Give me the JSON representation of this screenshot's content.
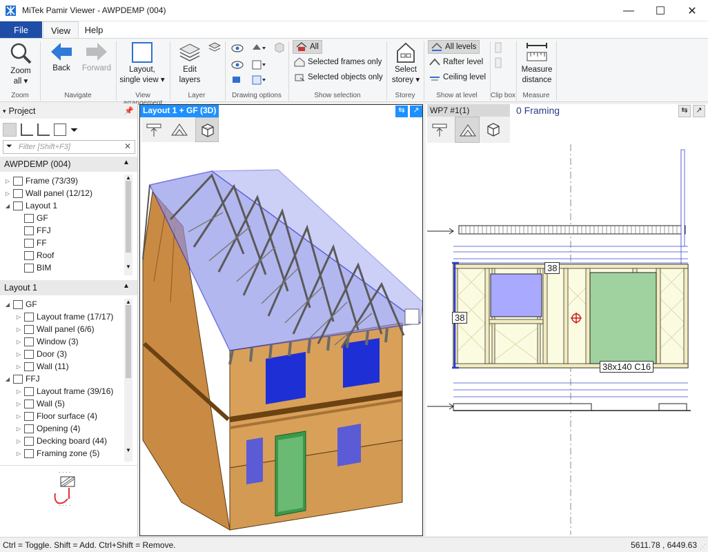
{
  "window": {
    "title": "MiTek Pamir Viewer - AWPDEMP (004)",
    "minimize": "—",
    "maximize": "☐",
    "close": "✕"
  },
  "tabs": {
    "file": "File",
    "view": "View",
    "help": "Help"
  },
  "ribbon": {
    "zoom": {
      "label": "Zoom all ▾",
      "group": "Zoom"
    },
    "back": "Back",
    "forward": "Forward",
    "navigate_group": "Navigate",
    "layout": {
      "label": "Layout, single view ▾",
      "group": "View arrangement"
    },
    "edit_layers": "Edit layers",
    "layer_group": "Layer",
    "drawing_group": "Drawing options",
    "all": "All",
    "selected_frames": "Selected frames only",
    "selected_objects": "Selected objects only",
    "selection_group": "Show selection",
    "select_storey": "Select storey ▾",
    "storey_group": "Storey",
    "all_levels": "All levels",
    "rafter_level": "Rafter level",
    "ceiling_level": "Ceiling level",
    "level_group": "Show at level",
    "clipbox_group": "Clip box",
    "measure": "Measure distance",
    "measure_group": "Measure"
  },
  "left": {
    "project_title": "Project",
    "filter_placeholder": "Filter [Shift+F3]",
    "section1": "AWPDEMP (004)",
    "tree1": [
      {
        "label": "Frame (73/39)",
        "exp": "▷",
        "indent": 0
      },
      {
        "label": "Wall panel (12/12)",
        "exp": "▷",
        "indent": 0
      },
      {
        "label": "Layout 1",
        "exp": "◢",
        "indent": 0
      },
      {
        "label": "GF",
        "exp": "",
        "indent": 1
      },
      {
        "label": "FFJ",
        "exp": "",
        "indent": 1
      },
      {
        "label": "FF",
        "exp": "",
        "indent": 1
      },
      {
        "label": "Roof",
        "exp": "",
        "indent": 1
      },
      {
        "label": "BIM",
        "exp": "",
        "indent": 1
      }
    ],
    "section2": "Layout 1",
    "tree2": [
      {
        "label": "GF",
        "exp": "◢",
        "indent": 0
      },
      {
        "label": "Layout frame (17/17)",
        "exp": "▷",
        "indent": 1
      },
      {
        "label": "Wall panel (6/6)",
        "exp": "▷",
        "indent": 1
      },
      {
        "label": "Window (3)",
        "exp": "▷",
        "indent": 1
      },
      {
        "label": "Door (3)",
        "exp": "▷",
        "indent": 1
      },
      {
        "label": "Wall (11)",
        "exp": "▷",
        "indent": 1
      },
      {
        "label": "FFJ",
        "exp": "◢",
        "indent": 0
      },
      {
        "label": "Layout frame (39/16)",
        "exp": "▷",
        "indent": 1
      },
      {
        "label": "Wall (5)",
        "exp": "▷",
        "indent": 1
      },
      {
        "label": "Floor surface (4)",
        "exp": "▷",
        "indent": 1
      },
      {
        "label": "Opening (4)",
        "exp": "▷",
        "indent": 1
      },
      {
        "label": "Decking board (44)",
        "exp": "▷",
        "indent": 1
      },
      {
        "label": "Framing zone (5)",
        "exp": "▷",
        "indent": 1
      }
    ]
  },
  "view3d": {
    "title": "Layout 1 + GF (3D)"
  },
  "view2d": {
    "tab": "WP7 #1(1)",
    "title": "0 Framing",
    "tag1": "38",
    "tag2": "38",
    "tag3": "38x140 C16"
  },
  "status": {
    "hint": "Ctrl = Toggle. Shift = Add.  Ctrl+Shift = Remove.",
    "coords": "5611.78 , 6449.63"
  },
  "colors": {
    "accent": "#1e4ea8",
    "viewport_title": "#1e90ff",
    "plywood": "#d9a05a",
    "glazing": "#1f2fd6"
  }
}
